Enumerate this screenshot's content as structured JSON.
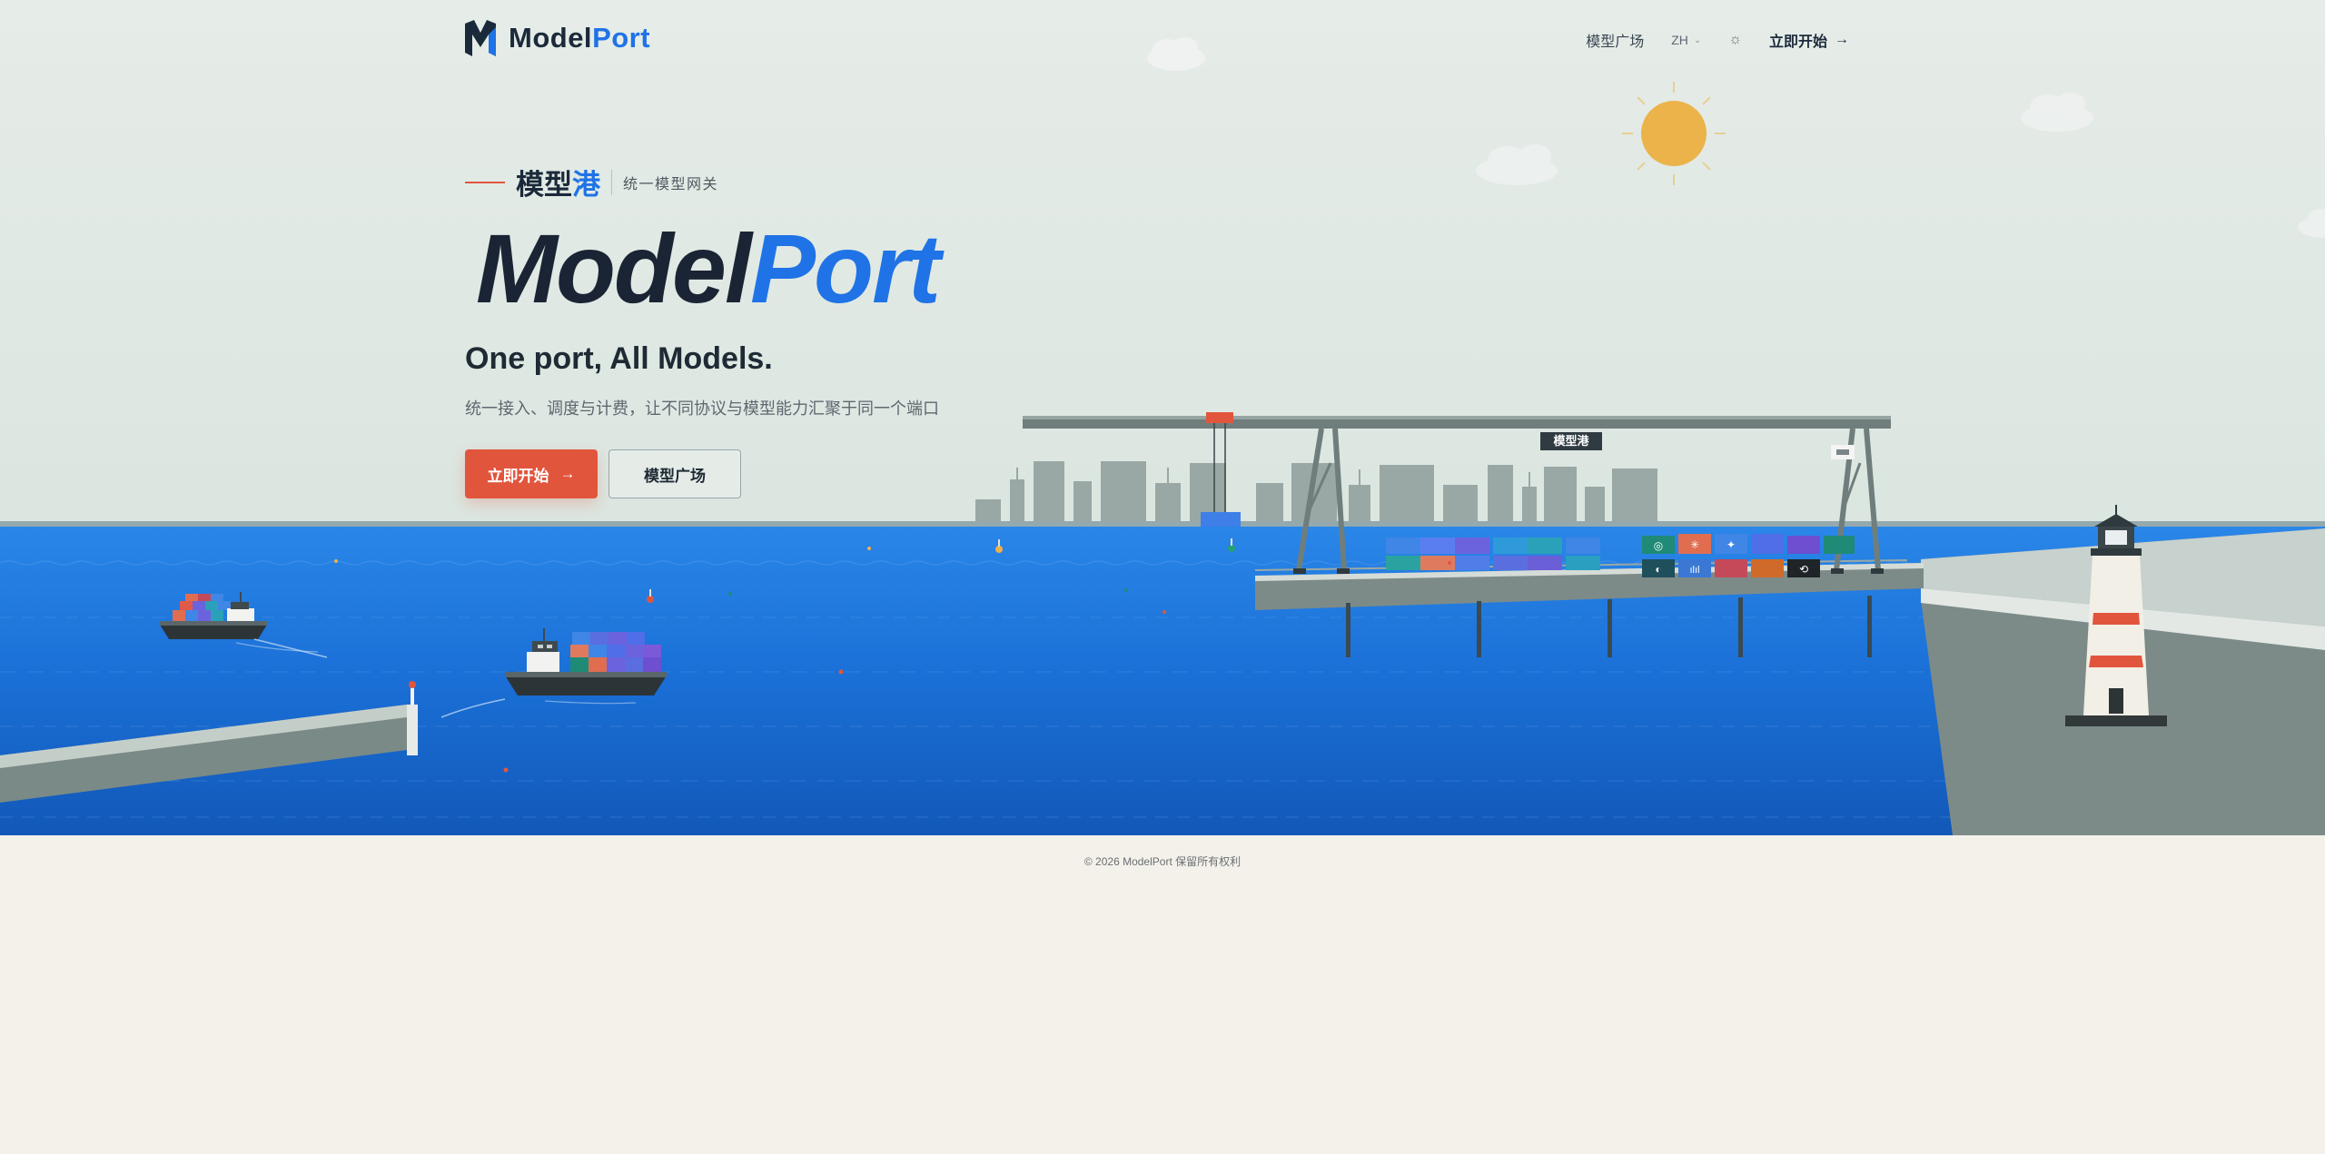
{
  "header": {
    "brand_model": "Model",
    "brand_port": "Port",
    "nav_models": "模型广场",
    "lang": "ZH",
    "theme_icon": "sun-icon",
    "start": "立即开始"
  },
  "hero": {
    "eyebrow_cn_a": "模型",
    "eyebrow_cn_b": "港",
    "eyebrow_sub": "统一模型网关",
    "title_model": "Model",
    "title_port": "Port",
    "tagline": "One port, All Models.",
    "description": "统一接入、调度与计费，让不同协议与模型能力汇聚于同一个端口",
    "btn_start": "立即开始",
    "btn_models": "模型广场"
  },
  "scene": {
    "crane_sign": "模型港"
  },
  "footer": {
    "copyright": "© 2026 ModelPort 保留所有权利"
  },
  "colors": {
    "accent": "#e2553d",
    "brand_blue": "#1f73e6",
    "dark": "#1b2a3a",
    "sea": "#1a6fd6"
  }
}
